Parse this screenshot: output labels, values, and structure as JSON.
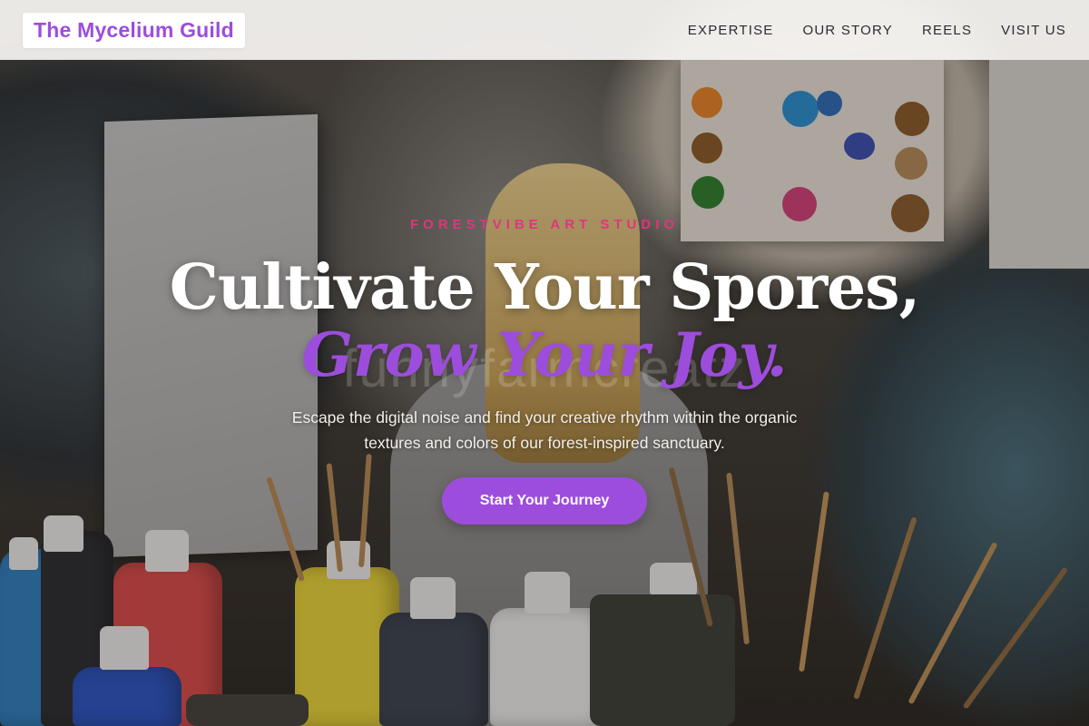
{
  "header": {
    "logo_text": "The Mycelium Guild",
    "nav": [
      {
        "label": "EXPERTISE"
      },
      {
        "label": "OUR STORY"
      },
      {
        "label": "REELS"
      },
      {
        "label": "VISIT US"
      }
    ]
  },
  "hero": {
    "eyebrow": "FORESTVIBE ART STUDIO",
    "headline": "Cultivate Your Spores,",
    "headline_accent": "Grow Your Joy.",
    "watermark": "funnyfarmcreatz",
    "description": "Escape the digital noise and find your creative rhythm within the organic textures and colors of our forest-inspired sanctuary.",
    "cta_label": "Start Your Journey",
    "background_image": "child-painting-in-art-studio"
  },
  "colors": {
    "brand_purple": "#9d4ddc",
    "eyebrow_pink": "#e0357e",
    "header_bg": "#f8f6f4",
    "nav_text": "#2b2b33"
  }
}
